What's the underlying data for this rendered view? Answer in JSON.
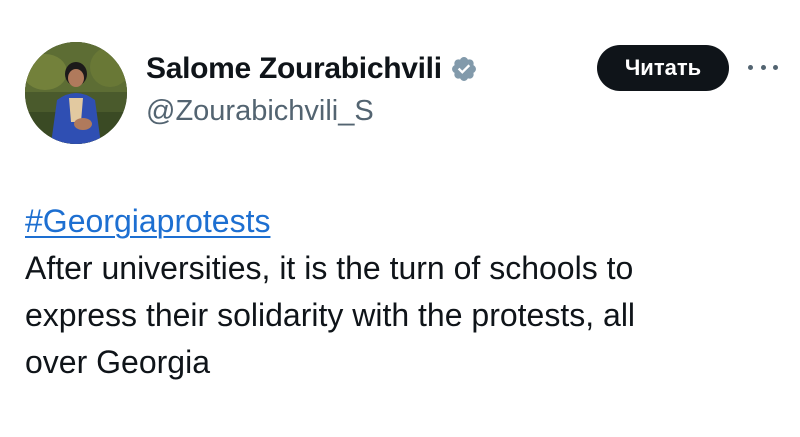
{
  "author": {
    "display_name": "Salome Zourabichvili",
    "handle": "@Zourabichvili_S",
    "verified_icon": "verified-badge-icon",
    "avatar_icon": "profile-photo"
  },
  "actions": {
    "follow_label": "Читать",
    "more_icon": "more-options-icon"
  },
  "tweet": {
    "hashtag": "#Georgiaprotests",
    "lines": [
      "After universities, it is the turn of schools to",
      "express their solidarity with the protests, all",
      "over Georgia"
    ]
  },
  "colors": {
    "text": "#0f1419",
    "secondary": "#536471",
    "link": "#1d6fd1",
    "button_bg": "#0f1419",
    "button_text": "#ffffff",
    "verified": "#829aab"
  }
}
